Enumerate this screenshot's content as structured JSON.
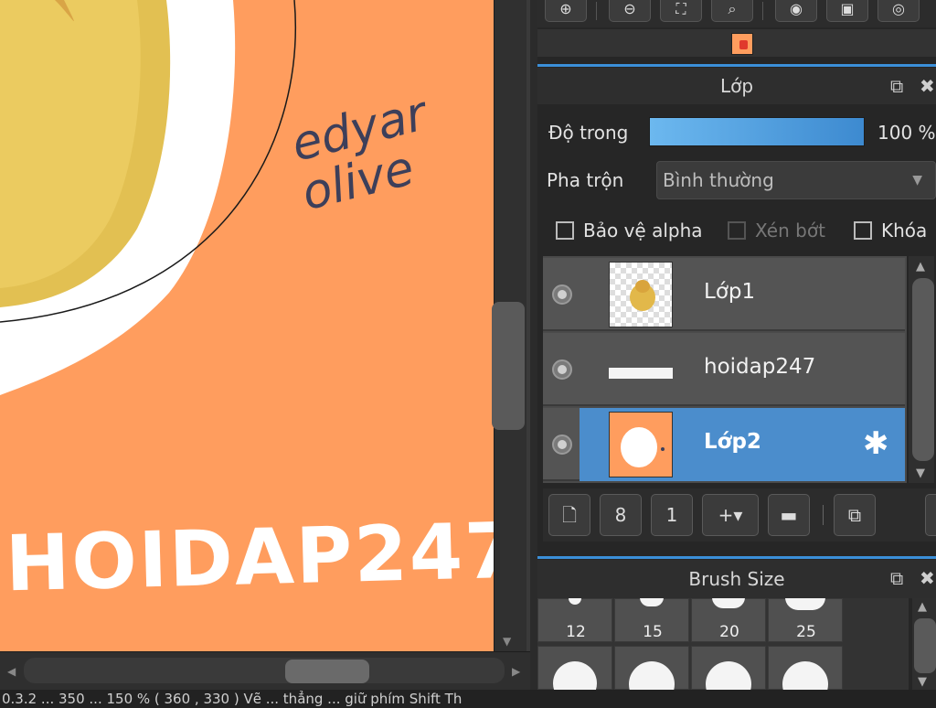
{
  "canvas": {
    "background_color": "#ff9d5e",
    "signature_line1": "edyar",
    "signature_line2": "olive",
    "watermark": "HOIDAP247"
  },
  "top_toolbar": {
    "icons": [
      "zoom-in-icon",
      "zoom-out-icon",
      "fit-screen-icon",
      "search-icon",
      "rotate-icon",
      "flip-icon",
      "reset-icon"
    ]
  },
  "colors": {
    "accent": "#3b8fd8",
    "selected_layer": "#4b8dcc",
    "canvas_bg": "#ff9d5e"
  },
  "layer_panel": {
    "title": "Lớp",
    "opacity_label": "Độ trong",
    "opacity_value": "100 %",
    "opacity_percent": 100,
    "blend_label": "Pha trộn",
    "blend_value": "Bình thường",
    "protect_alpha": "Bảo vệ alpha",
    "clipping": "Xén bớt",
    "lock": "Khóa",
    "layers": [
      {
        "name": "Lớp1",
        "selected": false
      },
      {
        "name": "hoidap247",
        "selected": false
      },
      {
        "name": "Lớp2",
        "selected": true
      }
    ],
    "toolbar_icons": [
      "new-layer-icon",
      "new-8bit-layer-icon",
      "new-1bit-layer-icon",
      "add-layer-menu-icon",
      "folder-icon",
      "duplicate-layer-icon"
    ]
  },
  "brush_panel": {
    "title": "Brush Size",
    "sizes": [
      "12",
      "15",
      "20",
      "25"
    ]
  },
  "status_bar": {
    "text": "0.3.2 ... 350 ... 150 % ( 360 , 330 )  Vẽ ... thẳng ... giữ phím Shift  Th"
  }
}
